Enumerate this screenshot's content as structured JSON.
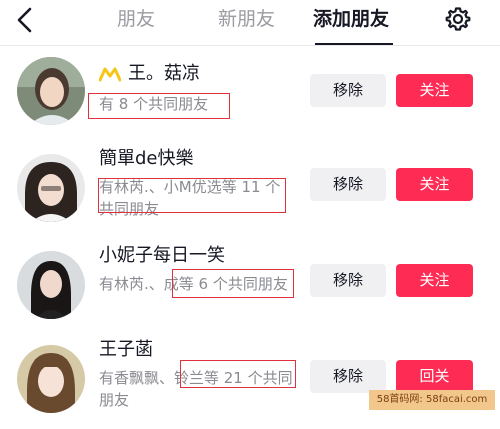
{
  "header": {
    "tabs": [
      {
        "label": "朋友",
        "active": false
      },
      {
        "label": "新朋友",
        "active": false
      },
      {
        "label": "添加朋友",
        "active": true
      }
    ],
    "back_icon": "chevron-left-icon",
    "settings_icon": "gear-icon"
  },
  "users": [
    {
      "name": "王。菇凉",
      "badge_icon": "crown-icon",
      "mutual": "有 8 个共同朋友",
      "remove_label": "移除",
      "action_label": "关注"
    },
    {
      "name": "簡單de快樂",
      "mutual": "有林芮.、小M优选等 11 个共同朋友",
      "remove_label": "移除",
      "action_label": "关注"
    },
    {
      "name": "小妮子每日一笑",
      "mutual": "有林芮.、成等 6 个共同朋友",
      "remove_label": "移除",
      "action_label": "关注"
    },
    {
      "name": "王子菡",
      "mutual": "有香飘飘、铃兰等 21 个共同朋友",
      "remove_label": "移除",
      "action_label": "回关"
    }
  ],
  "watermark": "58首码网: 58facai.com",
  "colors": {
    "accent": "#fe2c55",
    "highlight_box": "#e0323e",
    "crown": "#f5c518"
  }
}
